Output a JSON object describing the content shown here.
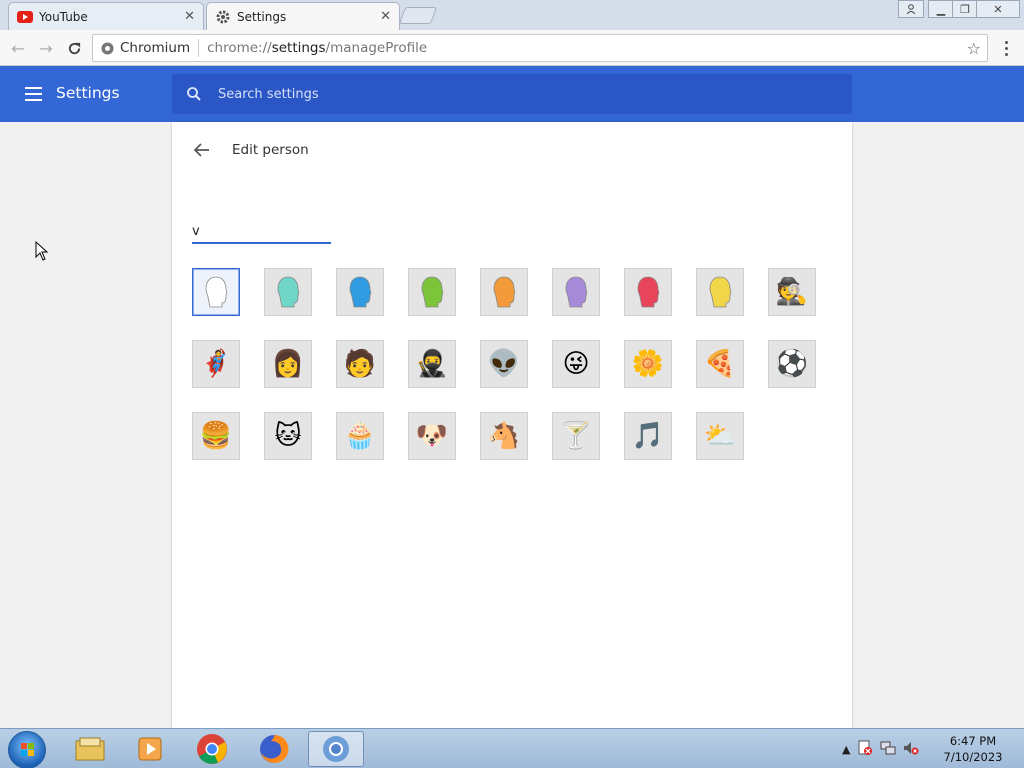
{
  "tabs": [
    {
      "title": "YouTube",
      "icon": "youtube-icon"
    },
    {
      "title": "Settings",
      "icon": "gear-icon"
    }
  ],
  "toolbar": {
    "site_chip": "Chromium",
    "url_scheme": "chrome://",
    "url_host": "settings",
    "url_path": "/manageProfile"
  },
  "header": {
    "title": "Settings",
    "search_placeholder": "Search settings"
  },
  "page": {
    "title": "Edit person",
    "name_value": "v"
  },
  "avatars": [
    {
      "name": "avatar-generic-white",
      "glyph": "white-head"
    },
    {
      "name": "avatar-generic-teal",
      "glyph": "teal-head"
    },
    {
      "name": "avatar-generic-blue",
      "glyph": "blue-head"
    },
    {
      "name": "avatar-generic-green",
      "glyph": "green-head"
    },
    {
      "name": "avatar-generic-orange",
      "glyph": "orange-head"
    },
    {
      "name": "avatar-generic-purple",
      "glyph": "purple-head"
    },
    {
      "name": "avatar-generic-red",
      "glyph": "red-head"
    },
    {
      "name": "avatar-generic-yellow",
      "glyph": "yellow-head"
    },
    {
      "name": "avatar-secret-agent",
      "glyph": "🕵"
    },
    {
      "name": "avatar-superhero",
      "glyph": "🦸"
    },
    {
      "name": "avatar-volleyball-player",
      "glyph": "👩"
    },
    {
      "name": "avatar-businessman",
      "glyph": "🧑"
    },
    {
      "name": "avatar-ninja",
      "glyph": "🥷"
    },
    {
      "name": "avatar-alien",
      "glyph": "👽"
    },
    {
      "name": "avatar-smiley",
      "glyph": "😜"
    },
    {
      "name": "avatar-flower",
      "glyph": "🌼"
    },
    {
      "name": "avatar-pizza",
      "glyph": "🍕"
    },
    {
      "name": "avatar-soccer",
      "glyph": "⚽"
    },
    {
      "name": "avatar-burger",
      "glyph": "🍔"
    },
    {
      "name": "avatar-cat",
      "glyph": "🐱"
    },
    {
      "name": "avatar-cupcake",
      "glyph": "🧁"
    },
    {
      "name": "avatar-dog",
      "glyph": "🐶"
    },
    {
      "name": "avatar-horse",
      "glyph": "🐴"
    },
    {
      "name": "avatar-margarita",
      "glyph": "🍸"
    },
    {
      "name": "avatar-note",
      "glyph": "🎵"
    },
    {
      "name": "avatar-sun-cloud",
      "glyph": "⛅"
    }
  ],
  "selected_avatar_index": 0,
  "taskbar": {
    "items": [
      "windows-explorer-icon",
      "media-player-icon",
      "chrome-icon",
      "firefox-icon",
      "chromium-icon"
    ],
    "active_item": "chromium-icon",
    "time": "6:47 PM",
    "date": "7/10/2023"
  },
  "colors": {
    "accent": "#3367d6",
    "search_bg": "#2a56c6"
  }
}
